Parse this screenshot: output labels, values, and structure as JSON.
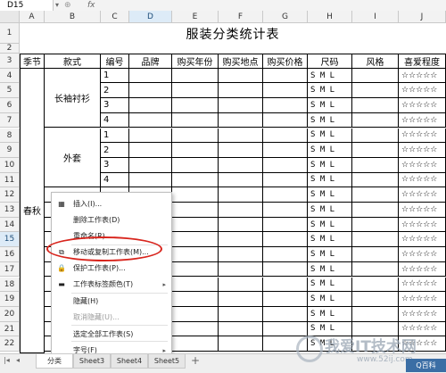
{
  "formula_bar": {
    "namebox": "D15",
    "fx": "fx"
  },
  "columns": [
    "A",
    "B",
    "C",
    "D",
    "E",
    "F",
    "G",
    "H",
    "I",
    "J"
  ],
  "rows": [
    "1",
    "2",
    "3",
    "4",
    "5",
    "6",
    "7",
    "8",
    "9",
    "10",
    "11",
    "12",
    "13",
    "14",
    "15",
    "16",
    "17",
    "18",
    "19",
    "20",
    "21",
    "22"
  ],
  "sheet": {
    "title": "服装分类统计表",
    "headers": [
      "季节",
      "款式",
      "编号",
      "品牌",
      "购买年份",
      "购买地点",
      "购买价格",
      "尺码",
      "风格",
      "喜爱程度"
    ],
    "season": "春秋",
    "style1": "长袖衬衫",
    "style2": "外套",
    "numbers": [
      "1",
      "2",
      "3",
      "4",
      "1",
      "2",
      "3",
      "4"
    ],
    "size": "S  M  L",
    "stars": "☆☆☆☆☆"
  },
  "context_menu": {
    "items": [
      {
        "label": "插入(I)...",
        "icon": "▦",
        "disabled": false
      },
      {
        "label": "删除工作表(D)",
        "icon": "",
        "disabled": false
      },
      {
        "label": "重命名(R)",
        "icon": "",
        "disabled": false
      },
      {
        "label": "移动或复制工作表(M)...",
        "icon": "⧉",
        "disabled": false
      },
      {
        "label": "保护工作表(P)...",
        "icon": "🔒",
        "disabled": false
      },
      {
        "label": "工作表标签颜色(T)",
        "icon": "▬",
        "disabled": false,
        "submenu": true
      },
      {
        "label": "隐藏(H)",
        "icon": "",
        "disabled": false
      },
      {
        "label": "取消隐藏(U)...",
        "icon": "",
        "disabled": true
      },
      {
        "label": "选定全部工作表(S)",
        "icon": "",
        "disabled": false
      },
      {
        "label": "字号(F)",
        "icon": "",
        "disabled": false,
        "submenu": true
      }
    ]
  },
  "tabs": [
    {
      "label": "分类"
    },
    {
      "label": "Sheet3"
    },
    {
      "label": "Sheet4"
    },
    {
      "label": "Sheet5"
    }
  ],
  "watermark": {
    "text": "我爱IT技术网",
    "url": "www.52ij.com",
    "badge": "Q百科"
  },
  "colors": {
    "highlight": "#d8241c",
    "active_header": "#ddebf7"
  }
}
